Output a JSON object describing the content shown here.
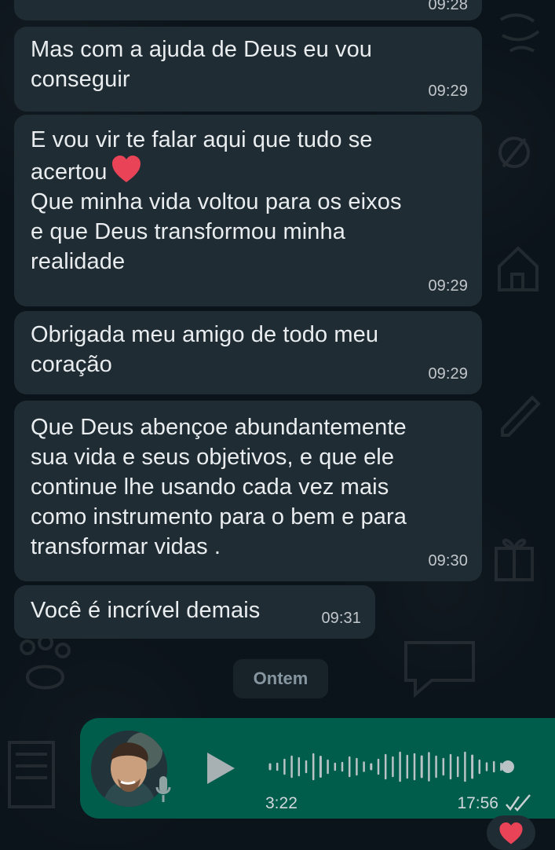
{
  "chat": {
    "previous_time_partial": "09:28",
    "messages": [
      {
        "text": "Mas com a ajuda de Deus eu vou\nconseguir",
        "time": "09:29"
      },
      {
        "text_before_emoji": "E vou vir te falar aqui que tudo se\nacertou",
        "emoji": "red-heart",
        "text_after_emoji": "\nQue minha vida voltou para os eixos\ne que Deus transformou minha\nrealidade",
        "time": "09:29"
      },
      {
        "text": "Obrigada meu amigo de todo meu\ncoração",
        "time": "09:29"
      },
      {
        "text": "Que Deus abençoe abundantemente\nsua vida e seus objetivos, e que ele\ncontinue lhe usando cada vez mais\ncomo instrumento para o bem e para\ntransformar vidas .",
        "time": "09:30"
      },
      {
        "text": "Você é incrível demais",
        "time": "09:31"
      }
    ],
    "date_separator": "Ontem",
    "voice_message": {
      "duration": "3:22",
      "time": "17:56",
      "status_icon": "double-check-icon",
      "playback_progress": 0.0
    },
    "reaction_emoji": "red-heart"
  },
  "colors": {
    "incoming_bubble": "#202c33",
    "outgoing_bubble": "#005c4b",
    "background": "#0b141a",
    "text": "#e9edef",
    "meta_text": "#c2c7cb",
    "heart": "#e84357"
  }
}
